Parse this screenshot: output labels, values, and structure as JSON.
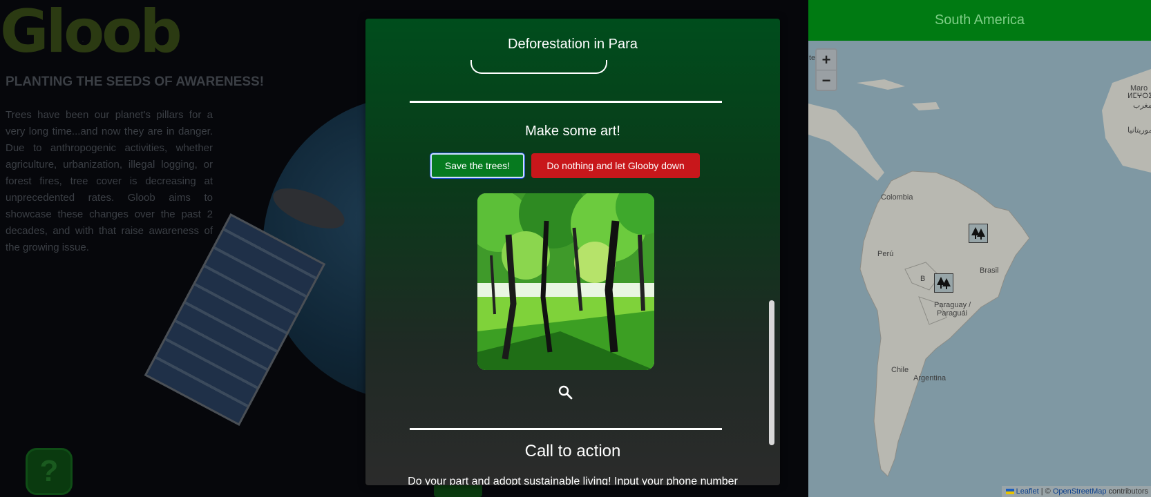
{
  "brand": {
    "logo_text": "Gloob"
  },
  "intro": {
    "tagline": "PLANTING THE SEEDS OF AWARENESS!",
    "body": "Trees have been our planet's pillars for a very long time...and now they are in danger. Due to anthropogenic activities, whether agriculture, urbanization, illegal logging, or forest fires, tree cover is decreasing at unprecedented rates. Gloob aims to showcase these changes over the past 2 decades, and with that raise awareness of the growing issue."
  },
  "help": {
    "label": "?"
  },
  "modal": {
    "title": "Deforestation in Para",
    "art_heading": "Make some art!",
    "save_button": "Save the trees!",
    "nothing_button": "Do nothing and let Glooby down",
    "cta_heading": "Call to action",
    "cta_text": "Do your part and adopt sustainable living! Input your phone number"
  },
  "map": {
    "header": "South America",
    "zoom_in": "+",
    "zoom_out": "−",
    "labels": {
      "colombia": "Colombia",
      "peru": "Perú",
      "brasil": "Brasil",
      "bolivia_partial": "B",
      "paraguay": "Paraguay /",
      "paraguai": "Paraguái",
      "chile": "Chile",
      "argentina": "Argentina",
      "te_partial": "te",
      "maro_partial": "Maro",
      "arabic1": "ⵍⵎⵖⵔⵉⴱ",
      "arabic2": "المغرب",
      "arabic3": "موريتانيا"
    },
    "attribution": {
      "leaflet": "Leaflet",
      "sep": " | © ",
      "osm": "OpenStreetMap",
      "contributors": " contributors"
    }
  }
}
